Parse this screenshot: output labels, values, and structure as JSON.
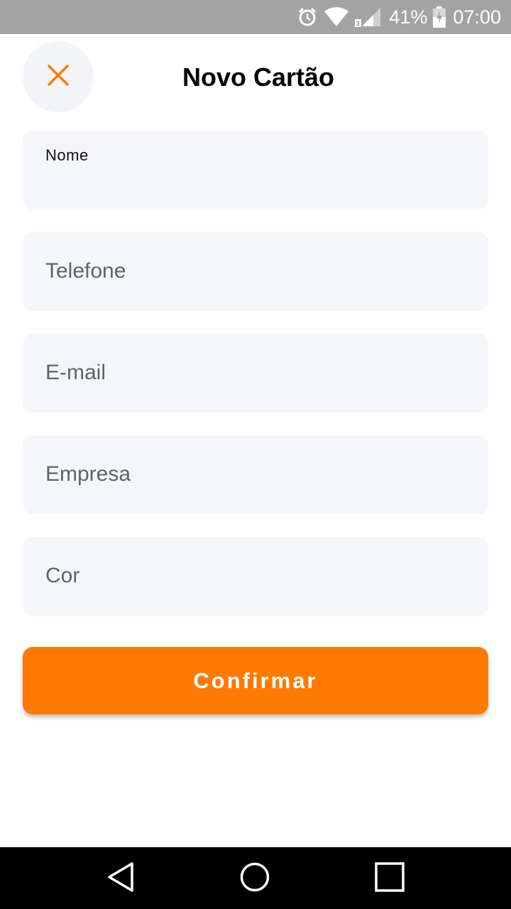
{
  "status_bar": {
    "battery": "41%",
    "time": "07:00",
    "icons": [
      "alarm-icon",
      "wifi-icon",
      "signal-icon",
      "battery-icon"
    ]
  },
  "header": {
    "title": "Novo Cartão",
    "close_icon": "close-icon"
  },
  "form": {
    "fields": [
      {
        "label": "Nome",
        "value": "",
        "placeholder": ""
      },
      {
        "label": "",
        "value": "",
        "placeholder": "Telefone"
      },
      {
        "label": "",
        "value": "",
        "placeholder": "E-mail"
      },
      {
        "label": "",
        "value": "",
        "placeholder": "Empresa"
      },
      {
        "label": "",
        "value": "",
        "placeholder": "Cor"
      }
    ]
  },
  "confirm_button": {
    "label": "Confirmar"
  },
  "colors": {
    "accent": "#ff7a00",
    "field_bg": "#f5f6fa",
    "status_bar_bg": "#a3a3a3",
    "nav_bar_bg": "#000000"
  },
  "nav_bar": {
    "icons": [
      "back-icon",
      "home-icon",
      "recents-icon"
    ]
  }
}
